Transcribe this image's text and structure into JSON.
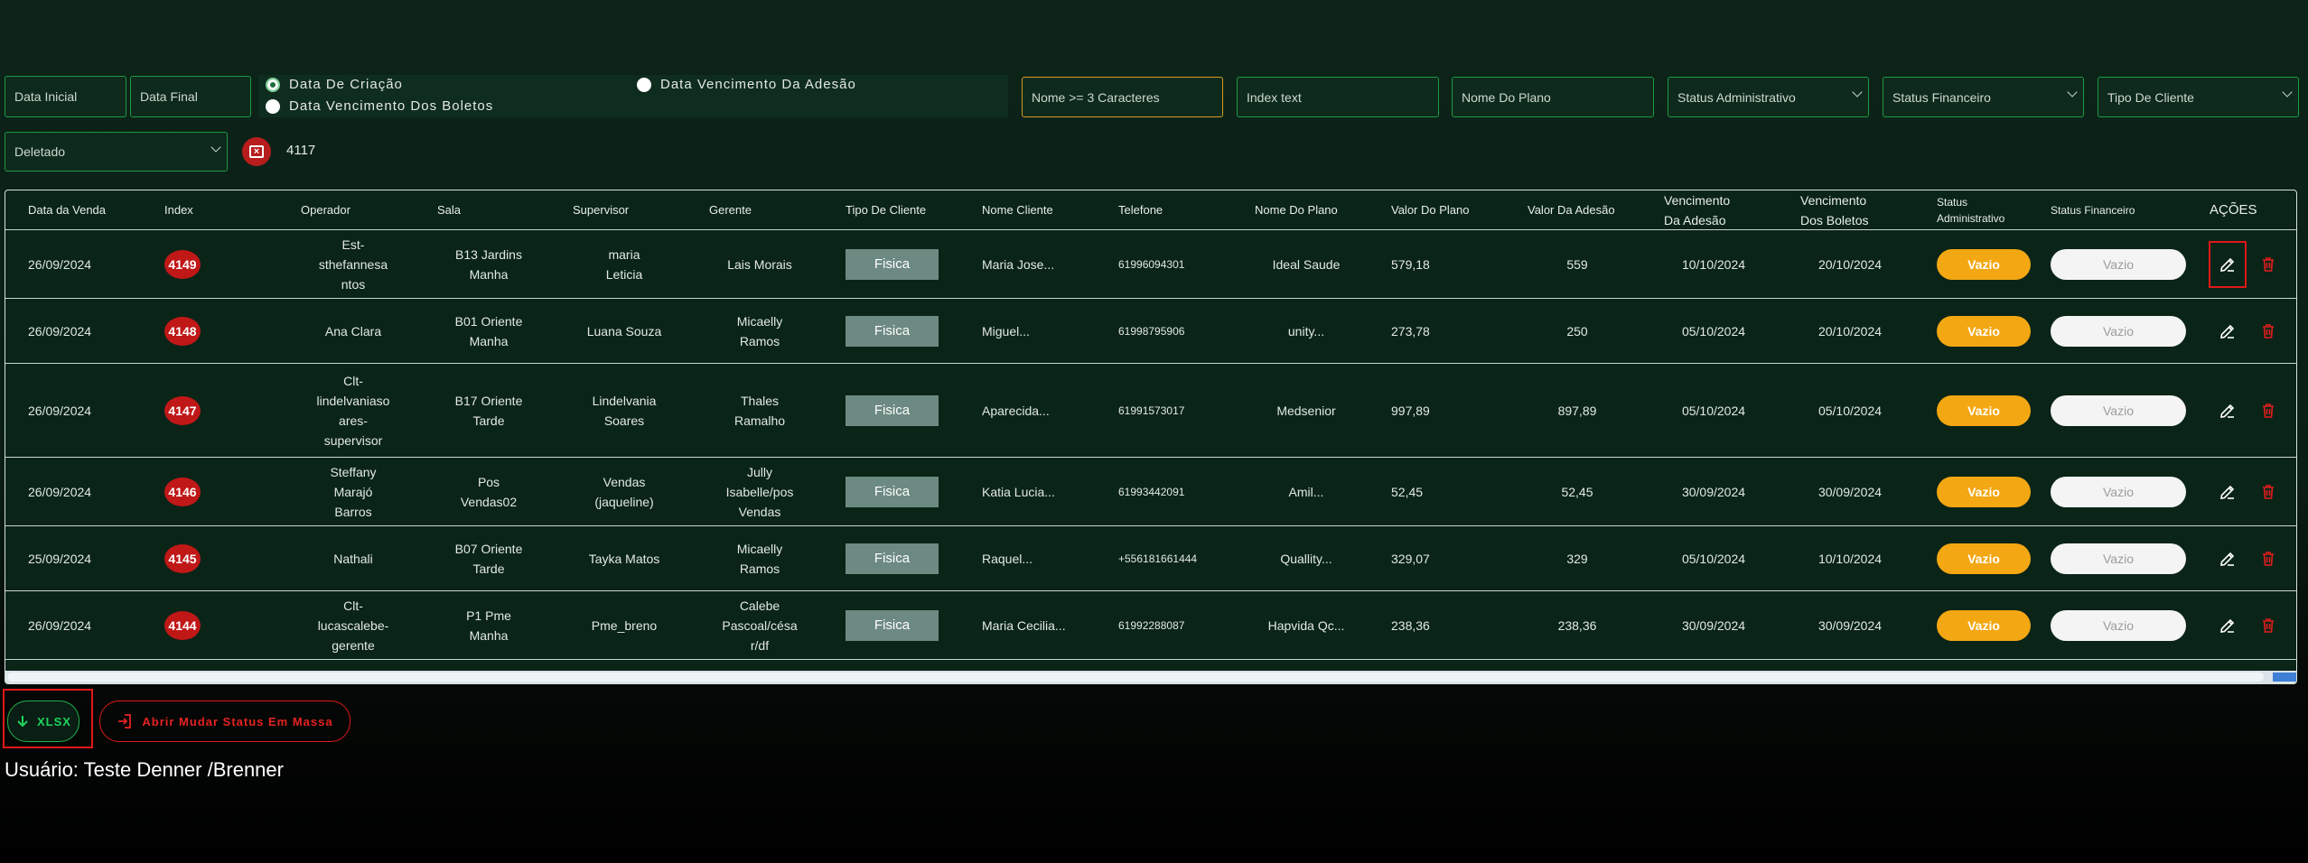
{
  "filters": {
    "data_inicial": "Data Inicial",
    "data_final": "Data Final",
    "radio_criacao": "Data De Criação",
    "radio_venc_boletos": "Data Vencimento Dos Boletos",
    "radio_venc_adesao": "Data Vencimento Da Adesão",
    "nome": "Nome >= 3 Caracteres",
    "index": "Index text",
    "nome_plano": "Nome Do Plano",
    "status_admin": "Status Administrativo",
    "status_fin": "Status Financeiro",
    "tipo_cliente": "Tipo De Cliente",
    "deletado": "Deletado",
    "count": "4117"
  },
  "table": {
    "headers": {
      "data_venda": "Data da Venda",
      "index": "Index",
      "operador": "Operador",
      "sala": "Sala",
      "supervisor": "Supervisor",
      "gerente": "Gerente",
      "tipo_cliente": "Tipo De Cliente",
      "nome_cliente": "Nome Cliente",
      "telefone": "Telefone",
      "nome_plano": "Nome Do Plano",
      "valor_plano": "Valor Do Plano",
      "valor_adesao": "Valor Da Adesão",
      "venc_adesao_1": "Vencimento",
      "venc_adesao_2": "Da Adesão",
      "venc_boletos_1": "Vencimento",
      "venc_boletos_2": "Dos Boletos",
      "status_admin_1": "Status",
      "status_admin_2": "Administrativo",
      "status_fin": "Status Financeiro",
      "acoes": "AÇÕES"
    },
    "rows": [
      {
        "data": "26/09/2024",
        "index": "4149",
        "operador": [
          "Est-",
          "sthefannesa",
          "ntos"
        ],
        "sala": [
          "B13 Jardins",
          "Manha"
        ],
        "supervisor": [
          "maria",
          "Leticia"
        ],
        "gerente": [
          "Lais Morais"
        ],
        "tipo": "Fisica",
        "cliente": "Maria Jose...",
        "telefone": "61996094301",
        "plano": "Ideal Saude",
        "valor_plano": "579,18",
        "valor_adesao": "559",
        "venc_adesao": "10/10/2024",
        "venc_boletos": "20/10/2024",
        "status_admin": "Vazio",
        "status_fin": "Vazio"
      },
      {
        "data": "26/09/2024",
        "index": "4148",
        "operador": [
          "Ana Clara"
        ],
        "sala": [
          "B01 Oriente",
          "Manha"
        ],
        "supervisor": [
          "Luana Souza"
        ],
        "gerente": [
          "Micaelly",
          "Ramos"
        ],
        "tipo": "Fisica",
        "cliente": "Miguel...",
        "telefone": "61998795906",
        "plano": "unity...",
        "valor_plano": "273,78",
        "valor_adesao": "250",
        "venc_adesao": "05/10/2024",
        "venc_boletos": "20/10/2024",
        "status_admin": "Vazio",
        "status_fin": "Vazio"
      },
      {
        "data": "26/09/2024",
        "index": "4147",
        "operador": [
          "Clt-",
          "lindelvaniaso",
          "ares-",
          "supervisor"
        ],
        "sala": [
          "B17 Oriente",
          "Tarde"
        ],
        "supervisor": [
          "Lindelvania",
          "Soares"
        ],
        "gerente": [
          "Thales",
          "Ramalho"
        ],
        "tipo": "Fisica",
        "cliente": "Aparecida...",
        "telefone": "61991573017",
        "plano": "Medsenior",
        "valor_plano": "997,89",
        "valor_adesao": "897,89",
        "venc_adesao": "05/10/2024",
        "venc_boletos": "05/10/2024",
        "status_admin": "Vazio",
        "status_fin": "Vazio"
      },
      {
        "data": "26/09/2024",
        "index": "4146",
        "operador": [
          "Steffany",
          "Marajó",
          "Barros"
        ],
        "sala": [
          "Pos",
          "Vendas02"
        ],
        "supervisor": [
          "Vendas",
          "(jaqueline)"
        ],
        "gerente": [
          "Jully",
          "Isabelle/pos",
          "Vendas"
        ],
        "tipo": "Fisica",
        "cliente": "Katia Lucia...",
        "telefone": "61993442091",
        "plano": "Amil...",
        "valor_plano": "52,45",
        "valor_adesao": "52,45",
        "venc_adesao": "30/09/2024",
        "venc_boletos": "30/09/2024",
        "status_admin": "Vazio",
        "status_fin": "Vazio"
      },
      {
        "data": "25/09/2024",
        "index": "4145",
        "operador": [
          "Nathali"
        ],
        "sala": [
          "B07 Oriente",
          "Tarde"
        ],
        "supervisor": [
          "Tayka Matos"
        ],
        "gerente": [
          "Micaelly",
          "Ramos"
        ],
        "tipo": "Fisica",
        "cliente": "Raquel...",
        "telefone": "+556181661444",
        "plano": "Quallity...",
        "valor_plano": "329,07",
        "valor_adesao": "329",
        "venc_adesao": "05/10/2024",
        "venc_boletos": "10/10/2024",
        "status_admin": "Vazio",
        "status_fin": "Vazio"
      },
      {
        "data": "26/09/2024",
        "index": "4144",
        "operador": [
          "Clt-",
          "lucascalebe-",
          "gerente"
        ],
        "sala": [
          "P1 Pme",
          "Manha"
        ],
        "supervisor": [
          "Pme_breno"
        ],
        "gerente": [
          "Calebe",
          "Pascoal/césa",
          "r/df"
        ],
        "tipo": "Fisica",
        "cliente": "Maria Cecilia...",
        "telefone": "61992288087",
        "plano": "Hapvida Qc...",
        "valor_plano": "238,36",
        "valor_adesao": "238,36",
        "venc_adesao": "30/09/2024",
        "venc_boletos": "30/09/2024",
        "status_admin": "Vazio",
        "status_fin": "Vazio"
      }
    ]
  },
  "actions": {
    "xlsx": "XLSX",
    "massa": "Abrir Mudar Status Em Massa"
  },
  "user_label": "Usuário: Teste Denner /Brenner",
  "colors": {
    "accent_green": "#1f9a45",
    "danger": "#e01818",
    "status_orange": "#f3a712",
    "tipo_gray": "#6d8a82"
  }
}
